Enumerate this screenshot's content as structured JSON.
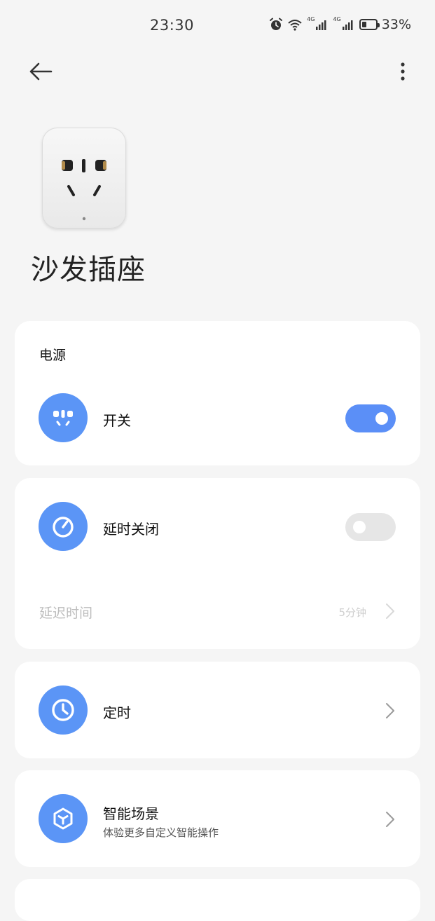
{
  "status_bar": {
    "time": "23:30",
    "network_1": "4G",
    "network_2": "4G",
    "battery_percent": "33%",
    "battery_level": 0.33,
    "icons": [
      "alarm-icon",
      "wifi-icon",
      "signal-icon",
      "signal-icon",
      "battery-icon"
    ]
  },
  "toolbar": {
    "back_icon": "arrow-left-icon",
    "more_icon": "more-vertical-icon"
  },
  "device": {
    "name": "沙发插座",
    "image": "power-socket-image"
  },
  "power_card": {
    "title": "电源",
    "switch": {
      "label": "开关",
      "icon": "socket-icon",
      "state": "on"
    }
  },
  "delay_card": {
    "label": "延时关闭",
    "icon": "timer-gauge-icon",
    "state": "off",
    "delay_label": "延迟时间",
    "delay_value": "5分钟"
  },
  "schedule_card": {
    "label": "定时",
    "icon": "clock-icon"
  },
  "scene_card": {
    "label": "智能场景",
    "sublabel": "体验更多自定义智能操作",
    "icon": "cube-icon"
  },
  "colors": {
    "accent": "#5b95f6",
    "background": "#f5f5f5",
    "card": "#ffffff"
  }
}
